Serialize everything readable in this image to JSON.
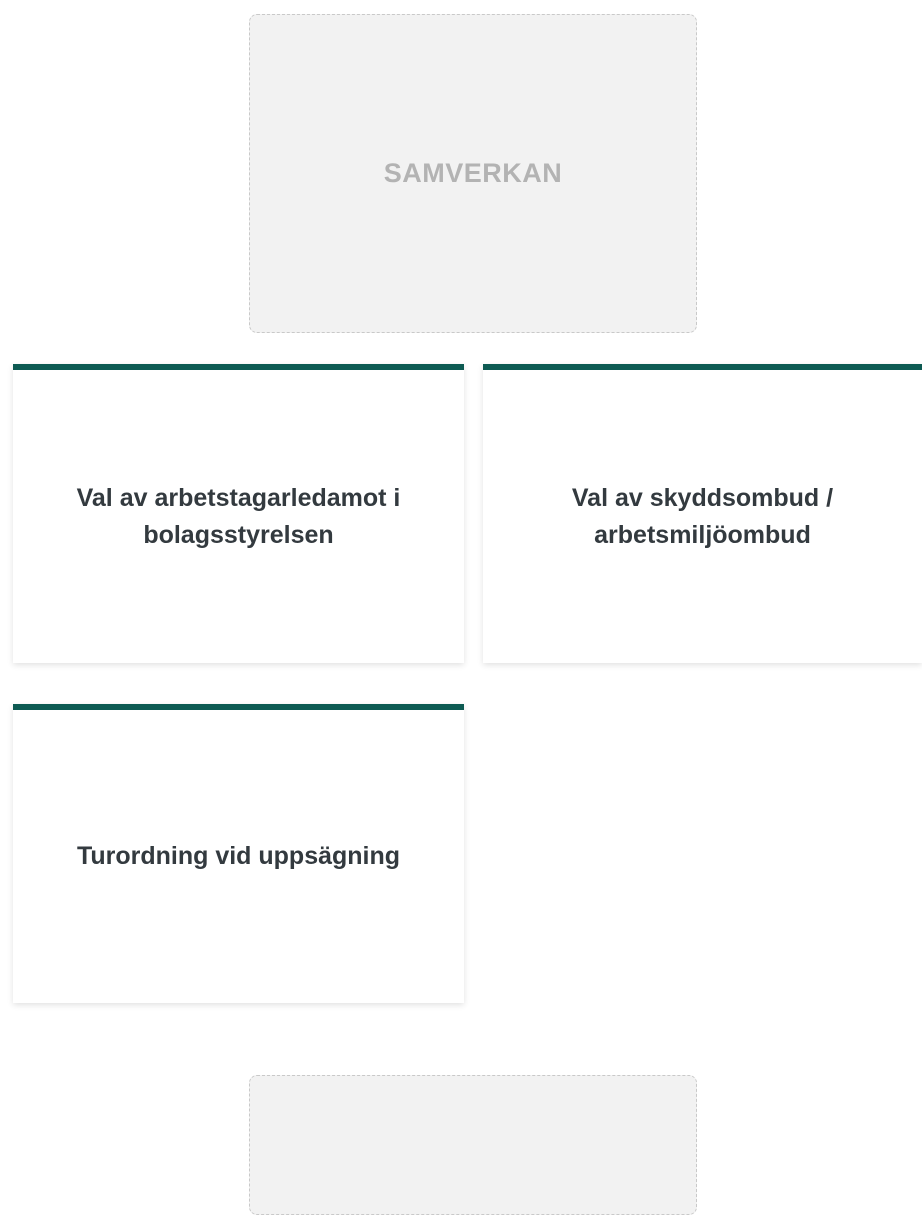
{
  "sections": {
    "top_placeholder": {
      "label": "SAMVERKAN"
    },
    "bottom_placeholder": {
      "label": ""
    }
  },
  "cards": [
    {
      "title": "Val av arbetstagarledamot i bolagsstyrelsen"
    },
    {
      "title": "Val av skyddsombud / arbetsmiljöombud"
    },
    {
      "title": "Turordning vid uppsägning"
    }
  ],
  "colors": {
    "card_accent": "#0d5a52",
    "placeholder_bg": "#f2f2f2",
    "placeholder_text": "#b3b3b3",
    "card_text": "#333a3f"
  }
}
